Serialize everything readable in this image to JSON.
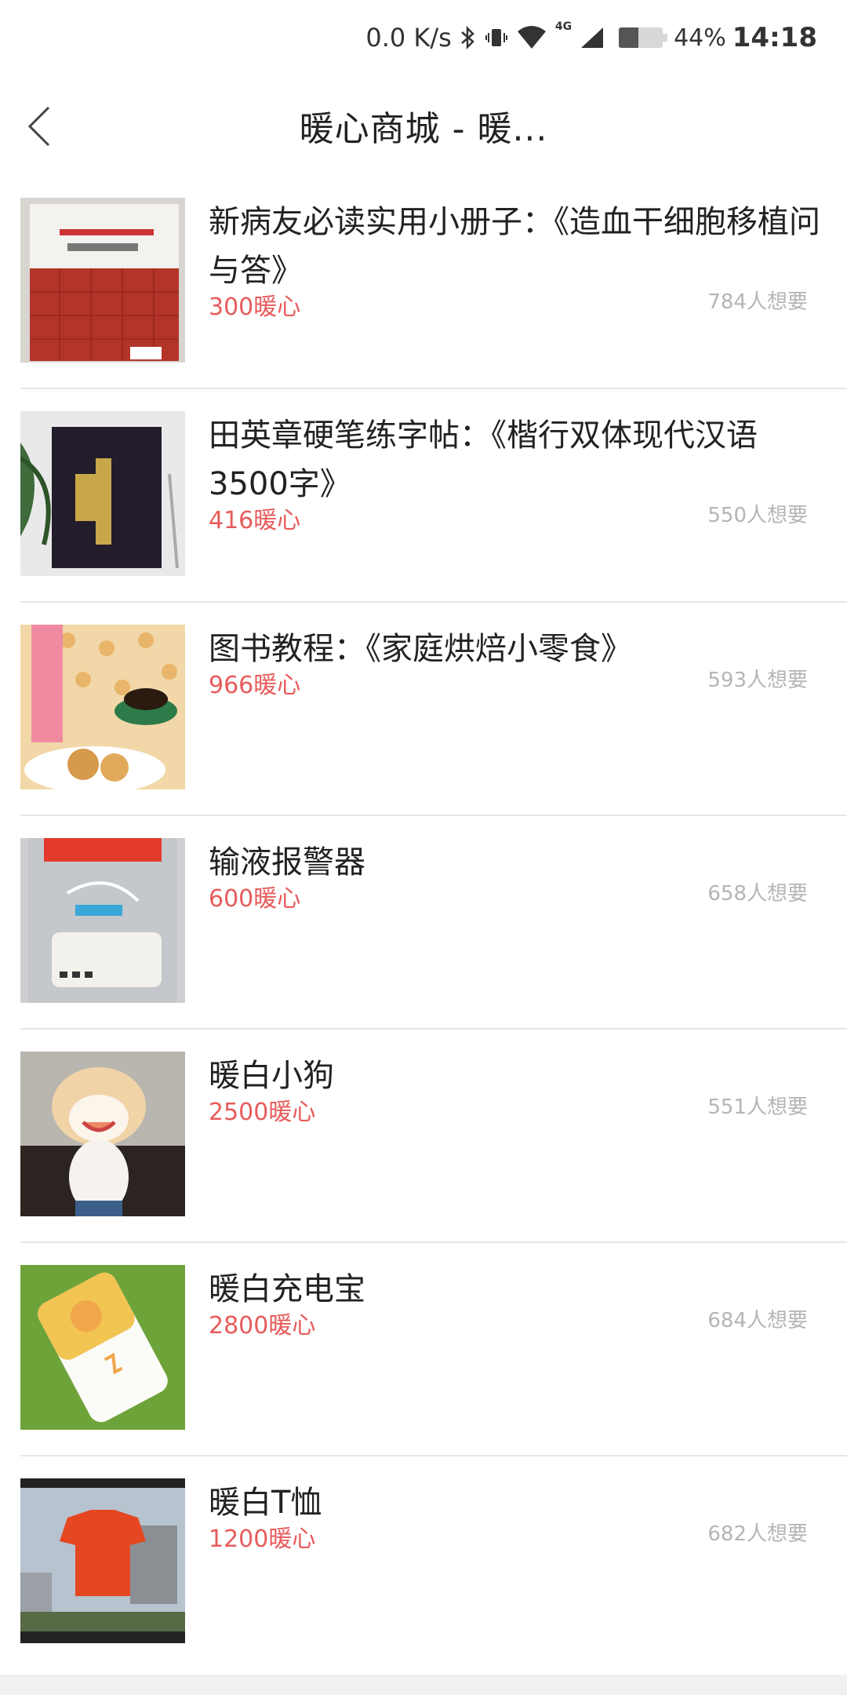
{
  "status_bar": {
    "speed": "0.0 K/s",
    "network": "4G",
    "battery_pct": "44%",
    "time": "14:18"
  },
  "header": {
    "title": "暖心商城 - 暖..."
  },
  "icons": {
    "back": "chevron-left-icon",
    "bluetooth": "bluetooth-icon",
    "vibrate": "vibrate-icon",
    "wifi": "wifi-icon",
    "signal": "signal-icon",
    "battery": "battery-icon"
  },
  "products": [
    {
      "title": "新病友必读实用小册子：《造血干细胞移植问与答》",
      "price": "300暖心",
      "wants": "784人想要"
    },
    {
      "title": "田英章硬笔练字帖：《楷行双体现代汉语3500字》",
      "price": "416暖心",
      "wants": "550人想要"
    },
    {
      "title": "图书教程：《家庭烘焙小零食》",
      "price": "966暖心",
      "wants": "593人想要"
    },
    {
      "title": "输液报警器",
      "price": "600暖心",
      "wants": "658人想要"
    },
    {
      "title": "暖白小狗",
      "price": "2500暖心",
      "wants": "551人想要"
    },
    {
      "title": "暖白充电宝",
      "price": "2800暖心",
      "wants": "684人想要"
    },
    {
      "title": "暖白T恤",
      "price": "1200暖心",
      "wants": "682人想要"
    }
  ],
  "colors": {
    "price": "#e85b5b",
    "wants": "#b5b5b5"
  }
}
